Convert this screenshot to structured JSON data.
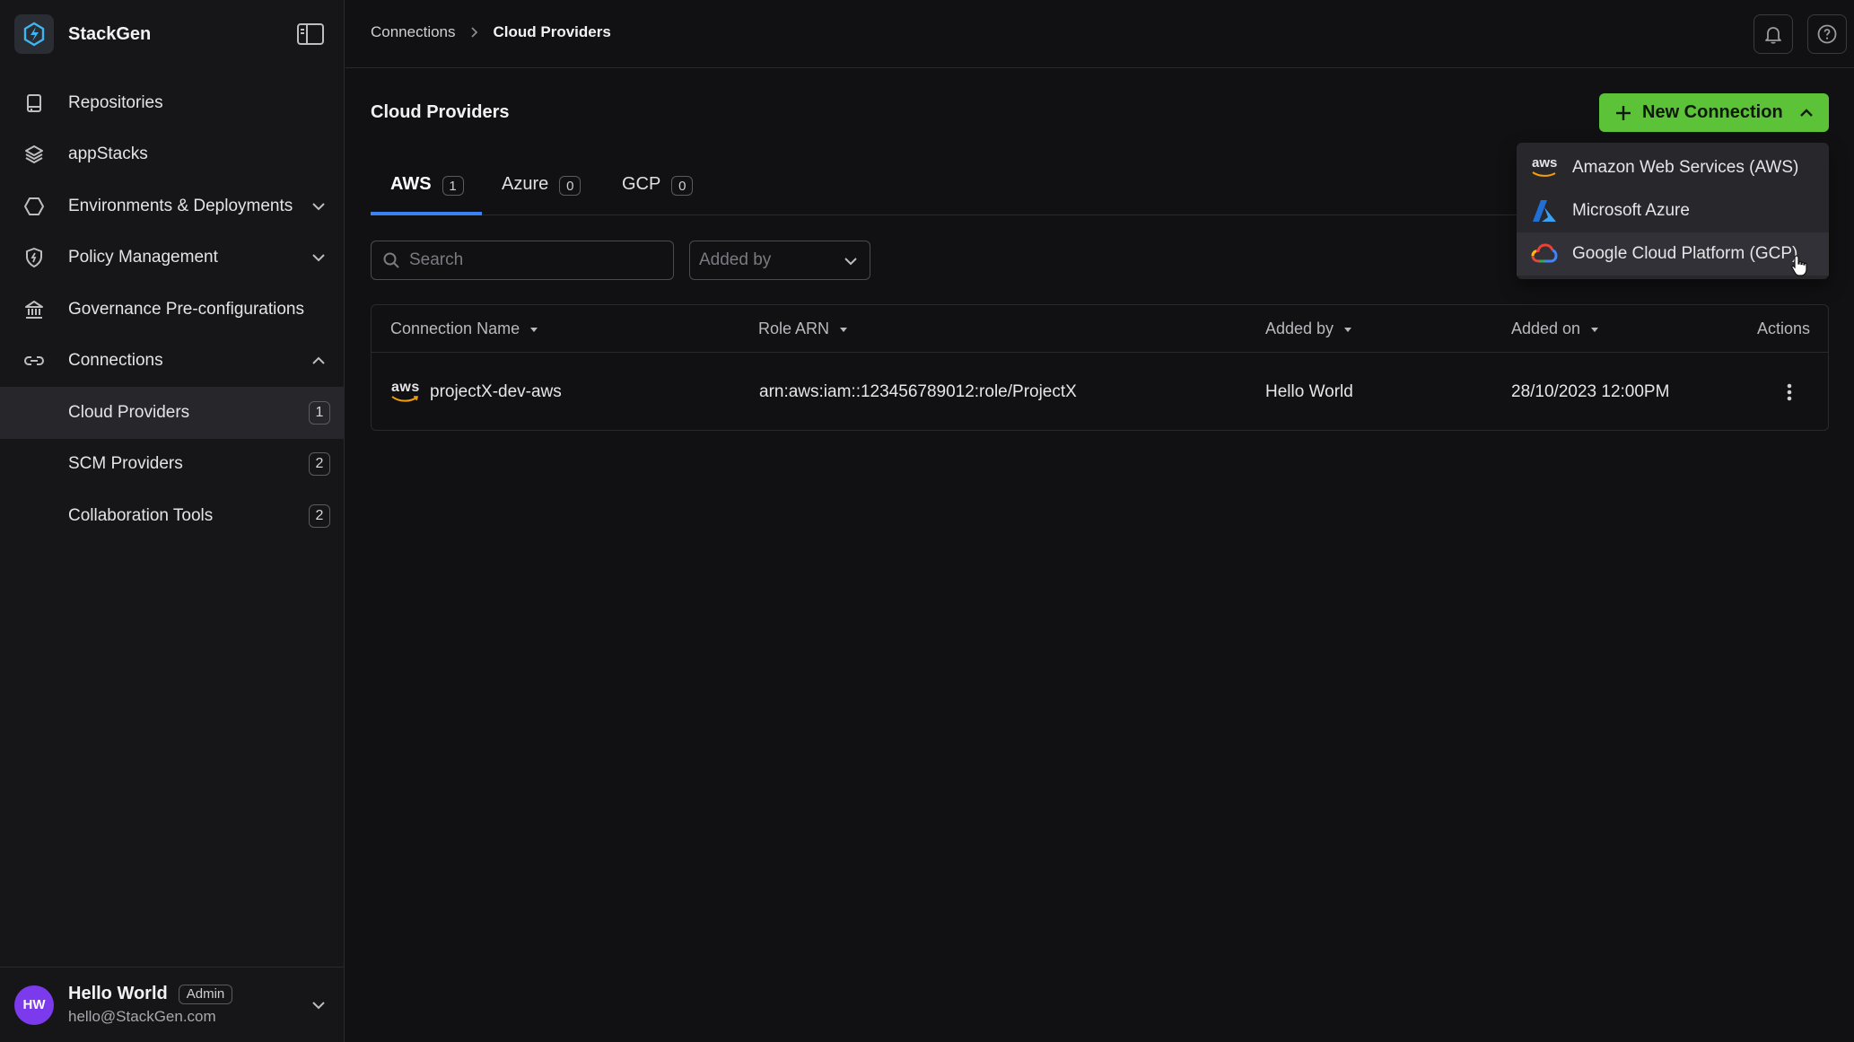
{
  "app": {
    "name": "StackGen"
  },
  "sidebar": {
    "items": [
      {
        "label": "Repositories",
        "icon": "repository-icon"
      },
      {
        "label": "appStacks",
        "icon": "layers-icon"
      },
      {
        "label": "Environments & Deployments",
        "icon": "hexagon-icon",
        "expanded": false
      },
      {
        "label": "Policy Management",
        "icon": "shield-icon",
        "expanded": false
      },
      {
        "label": "Governance Pre-configurations",
        "icon": "bank-icon"
      },
      {
        "label": "Connections",
        "icon": "link-icon",
        "expanded": true
      }
    ],
    "subitems": [
      {
        "label": "Cloud Providers",
        "count": "1",
        "active": true
      },
      {
        "label": "SCM Providers",
        "count": "2",
        "active": false
      },
      {
        "label": "Collaboration Tools",
        "count": "2",
        "active": false
      }
    ]
  },
  "user": {
    "initials": "HW",
    "name": "Hello World",
    "role": "Admin",
    "email": "hello@StackGen.com"
  },
  "breadcrumb": {
    "parent": "Connections",
    "current": "Cloud Providers"
  },
  "page": {
    "title": "Cloud Providers",
    "new_connection_label": "New Connection"
  },
  "tabs": [
    {
      "label": "AWS",
      "count": "1",
      "active": true
    },
    {
      "label": "Azure",
      "count": "0",
      "active": false
    },
    {
      "label": "GCP",
      "count": "0",
      "active": false
    }
  ],
  "filters": {
    "search_placeholder": "Search",
    "added_by_placeholder": "Added by"
  },
  "table": {
    "columns": [
      "Connection Name",
      "Role ARN",
      "Added by",
      "Added on",
      "Actions"
    ],
    "rows": [
      {
        "name": "projectX-dev-aws",
        "provider_logo_text": "aws",
        "role_arn": "arn:aws:iam::123456789012:role/ProjectX",
        "added_by": "Hello World",
        "added_on": "28/10/2023 12:00PM"
      }
    ]
  },
  "dropdown": {
    "items": [
      {
        "label": "Amazon Web Services (AWS)",
        "icon": "aws-logo-icon",
        "logo_text": "aws"
      },
      {
        "label": "Microsoft Azure",
        "icon": "azure-logo-icon"
      },
      {
        "label": "Google Cloud Platform (GCP)",
        "icon": "gcp-logo-icon",
        "hovered": true
      }
    ]
  },
  "colors": {
    "accent_green": "#5cc238",
    "tab_active": "#3b82f6",
    "avatar": "#7c3aed",
    "background": "#111113"
  }
}
